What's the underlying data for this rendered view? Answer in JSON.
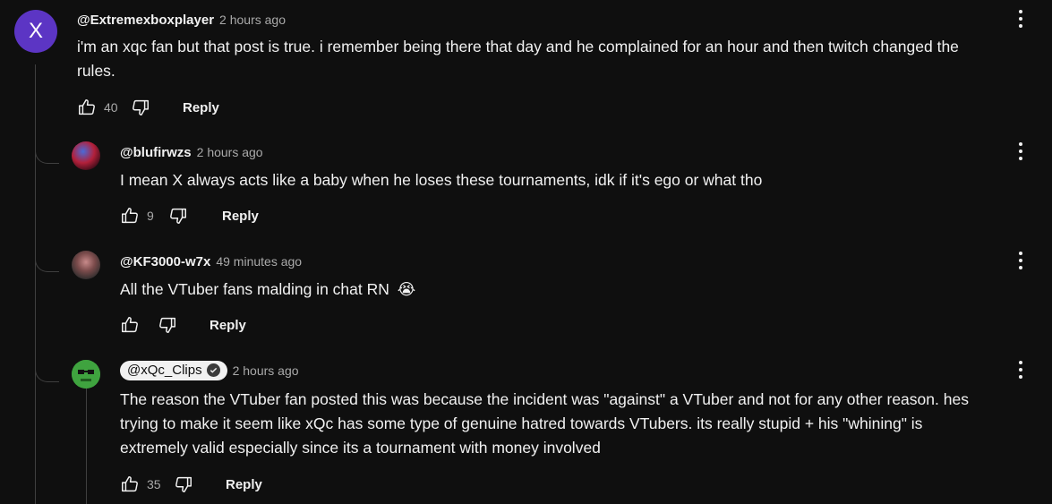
{
  "comments": [
    {
      "avatar_letter": "X",
      "avatar_color": "#5c35c4",
      "author": "@Extremexboxplayer",
      "time": "2 hours ago",
      "text_lines": [
        "i'm an xqc fan but that post is true. i remember being there that day and he complained for an hour and then twitch changed the",
        "rules."
      ],
      "likes": "40",
      "reply_label": "Reply"
    }
  ],
  "replies": [
    {
      "author": "@blufirwzs",
      "time": "2 hours ago",
      "text": "I mean X always acts like a baby when he loses these tournaments, idk if it's ego or what tho",
      "likes": "9",
      "reply_label": "Reply"
    },
    {
      "author": "@KF3000-w7x",
      "time": "49 minutes ago",
      "text": "All the VTuber fans malding in chat RN",
      "emoji": "😭",
      "likes": "",
      "reply_label": "Reply"
    },
    {
      "author": "@xQc_Clips",
      "is_channel_owner": true,
      "time": "2 hours ago",
      "text_lines": [
        "The reason the VTuber fan posted this was because the incident was \"against\" a VTuber and not for any other reason. hes",
        "trying to make it seem like xQc has some type of genuine hatred towards VTubers. its really stupid + his \"whining\" is",
        "extremely valid especially since its a tournament with money involved"
      ],
      "likes": "35",
      "reply_label": "Reply"
    }
  ],
  "icons": {
    "like": "thumbs-up-icon",
    "dislike": "thumbs-down-icon",
    "menu": "more-vert-icon",
    "verified": "check-circle-icon"
  },
  "colors": {
    "background": "#0f0f0f",
    "text": "#f1f1f1",
    "muted": "#aaaaaa",
    "thread_line": "#3f3f3f"
  }
}
